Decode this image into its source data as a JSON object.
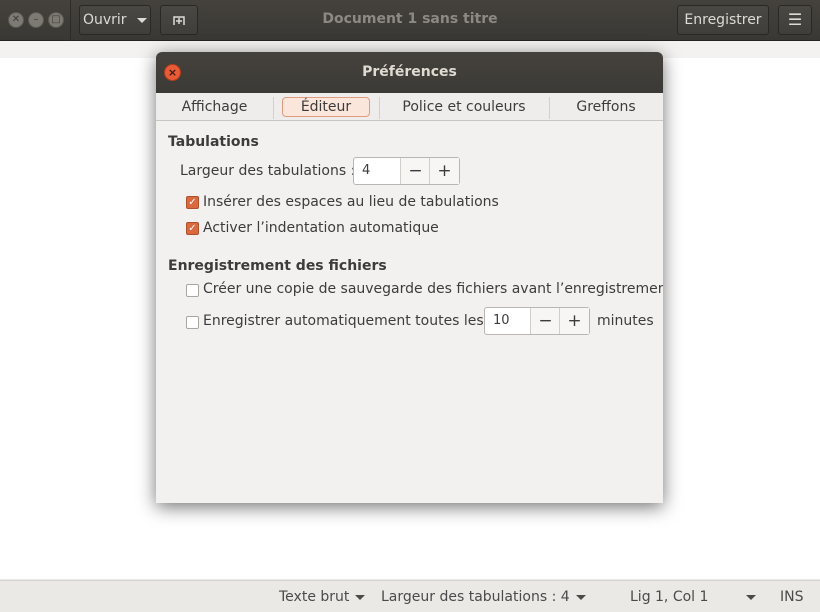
{
  "window": {
    "title": "Document 1 sans titre",
    "open_label": "Ouvrir",
    "save_label": "Enregistrer"
  },
  "dialog": {
    "title": "Préférences",
    "tabs": [
      {
        "label": "Affichage",
        "active": false
      },
      {
        "label": "Éditeur",
        "active": true
      },
      {
        "label": "Police et couleurs",
        "active": false
      },
      {
        "label": "Greffons",
        "active": false
      }
    ],
    "tabulations": {
      "heading": "Tabulations",
      "width_label": "Largeur des tabulations :",
      "width_value": "4",
      "insert_spaces": {
        "label": "Insérer des espaces au lieu de tabulations",
        "checked": true
      },
      "auto_indent": {
        "label": "Activer l’indentation automatique",
        "checked": true
      }
    },
    "saving": {
      "heading": "Enregistrement des fichiers",
      "backup": {
        "label": "Créer une copie de sauvegarde des fichiers avant l’enregistrement",
        "checked": false
      },
      "autosave": {
        "label": "Enregistrer automatiquement toutes les",
        "checked": false,
        "value": "10",
        "unit": "minutes"
      }
    }
  },
  "statusbar": {
    "language": "Texte brut",
    "tab_width": "Largeur des tabulations : 4",
    "position": "Lig 1, Col 1",
    "mode": "INS"
  },
  "colors": {
    "accent": "#d9693f",
    "headerbar": "#3c3a36",
    "close_button": "#e95a36"
  }
}
